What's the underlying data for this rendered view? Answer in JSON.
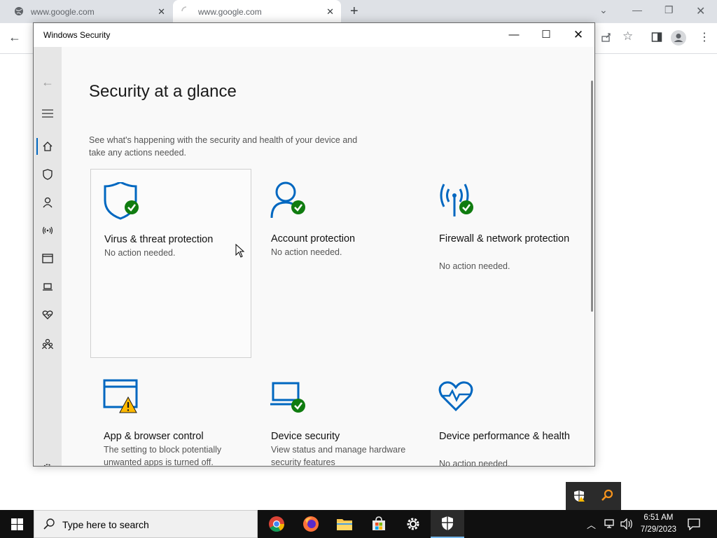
{
  "browser": {
    "tabs": [
      {
        "title": "www.google.com",
        "loading": false
      },
      {
        "title": "www.google.com",
        "loading": true
      }
    ],
    "new_tab_label": "+"
  },
  "window": {
    "title": "Windows Security"
  },
  "page": {
    "title": "Security at a glance",
    "description": "See what's happening with the security and health of your device and take any actions needed."
  },
  "sidebar": {
    "items": [
      {
        "icon": "home-icon",
        "active": true
      },
      {
        "icon": "shield-icon"
      },
      {
        "icon": "person-icon"
      },
      {
        "icon": "wifi-icon"
      },
      {
        "icon": "app-browser-icon"
      },
      {
        "icon": "laptop-icon"
      },
      {
        "icon": "heart-icon"
      },
      {
        "icon": "family-icon"
      }
    ],
    "settings_icon": "gear-icon"
  },
  "tiles": [
    {
      "title": "Virus & threat protection",
      "status": "No action needed.",
      "icon": "shield-check-icon",
      "state": "ok"
    },
    {
      "title": "Account protection",
      "status": "No action needed.",
      "icon": "person-check-icon",
      "state": "ok"
    },
    {
      "title": "Firewall & network protection",
      "status": "No action needed.",
      "icon": "antenna-check-icon",
      "state": "ok"
    },
    {
      "title": "App & browser control",
      "status": "The setting to block potentially unwanted apps is turned off.",
      "icon": "app-browser-warning-icon",
      "state": "warning"
    },
    {
      "title": "Device security",
      "status": "View status and manage hardware security features",
      "icon": "laptop-check-icon",
      "state": "ok"
    },
    {
      "title": "Device performance & health",
      "status": "No action needed.",
      "icon": "heart-pulse-icon",
      "state": "ok"
    }
  ],
  "taskbar": {
    "search_placeholder": "Type here to search",
    "time": "6:51 AM",
    "date": "7/29/2023",
    "apps": [
      "chrome-icon",
      "firefox-icon",
      "file-explorer-icon",
      "store-icon",
      "settings-icon",
      "windows-security-icon"
    ]
  },
  "colors": {
    "accent": "#0067c0",
    "ok": "#107c10",
    "warning": "#ffb900"
  }
}
